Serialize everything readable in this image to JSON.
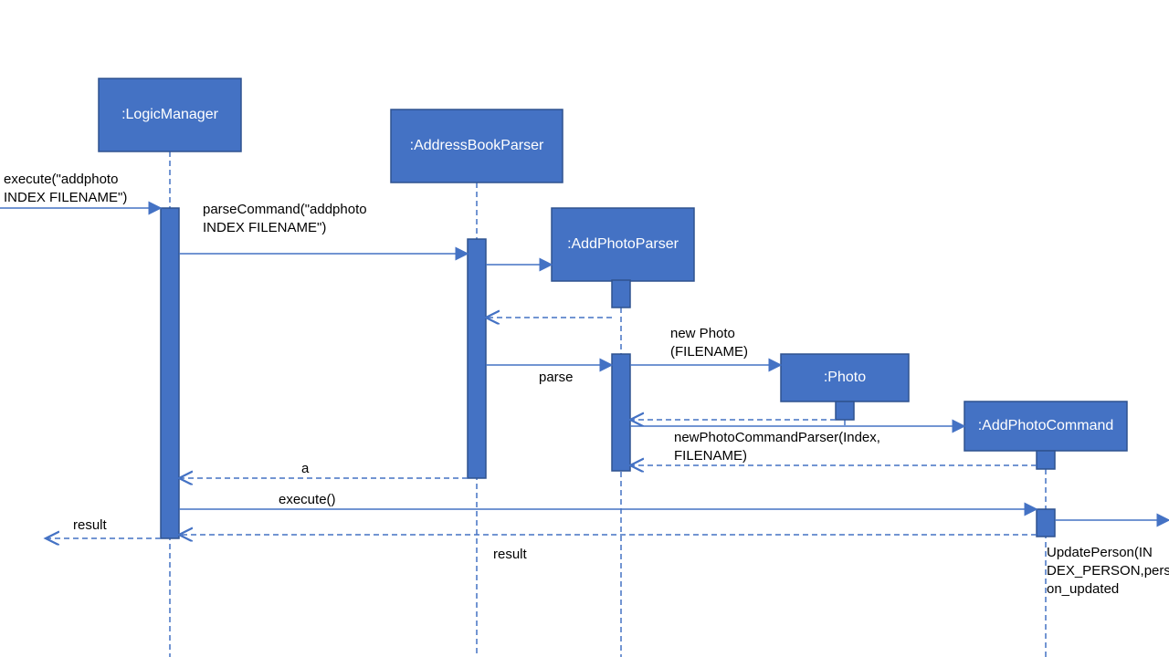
{
  "diagram": {
    "type": "sequence",
    "participants": {
      "logicManager": ":LogicManager",
      "addressBookParser": ":AddressBookParser",
      "addPhotoParser": ":AddPhotoParser",
      "photo": ":Photo",
      "addPhotoCommand": ":AddPhotoCommand"
    },
    "messages": {
      "execute1a": "execute(\"addphoto",
      "execute1b": "INDEX FILENAME\")",
      "parseCommand1a": "parseCommand(\"addphoto",
      "parseCommand1b": "INDEX FILENAME\")",
      "parse": "parse",
      "newPhoto1": "new Photo",
      "newPhoto2": "(FILENAME)",
      "newPhotoCmd1": "newPhotoCommandParser(Index,",
      "newPhotoCmd2": "FILENAME)",
      "a": "a",
      "execute2": "execute()",
      "result": "result",
      "result2": "result",
      "updatePerson1": "UpdatePerson(IN",
      "updatePerson2": "DEX_PERSON,pers",
      "updatePerson3": "on_updated"
    }
  }
}
